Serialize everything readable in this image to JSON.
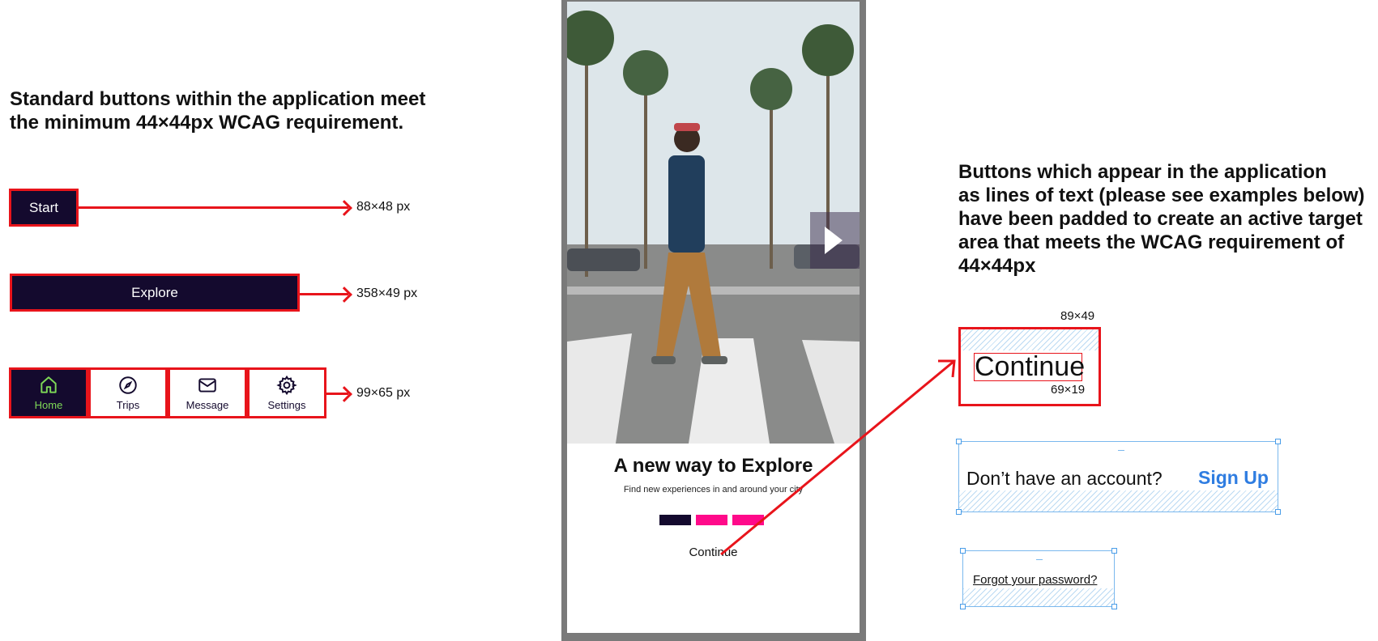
{
  "left": {
    "heading_line1": "Standard buttons within the application meet",
    "heading_line2": "the minimum 44×44px WCAG requirement.",
    "start_button": "Start",
    "start_dim": "88×48 px",
    "explore_button": "Explore",
    "explore_dim": "358×49 px",
    "nav_dim": "99×65 px",
    "nav_items": [
      {
        "label": "Home",
        "icon": "home-icon"
      },
      {
        "label": "Trips",
        "icon": "compass-icon"
      },
      {
        "label": "Message",
        "icon": "mail-icon"
      },
      {
        "label": "Settings",
        "icon": "gear-icon"
      }
    ]
  },
  "phone": {
    "title": "A new way to Explore",
    "subtitle": "Find new experiences in and around your city",
    "continue": "Continue",
    "pager_colors": [
      "#140a2e",
      "#ff0a8a",
      "#ff0a8a"
    ]
  },
  "right": {
    "heading_lines": [
      "Buttons which appear in the application",
      "as lines of text (please see examples below)",
      "have been padded to create an active target",
      "area that meets the WCAG requirement of",
      "44×44px"
    ],
    "continue_label": "Continue",
    "outer_dim": "89×49",
    "inner_dim": "69×19",
    "signup_prompt": "Don’t have an account?",
    "signup_link": "Sign Up",
    "forgot_link": "Forgot your password?"
  },
  "colors": {
    "accent_red": "#e8141b",
    "brand_dark": "#140a2e",
    "brand_pink": "#ff0a8a",
    "link_blue": "#2f7de1",
    "active_green": "#7ed957"
  }
}
